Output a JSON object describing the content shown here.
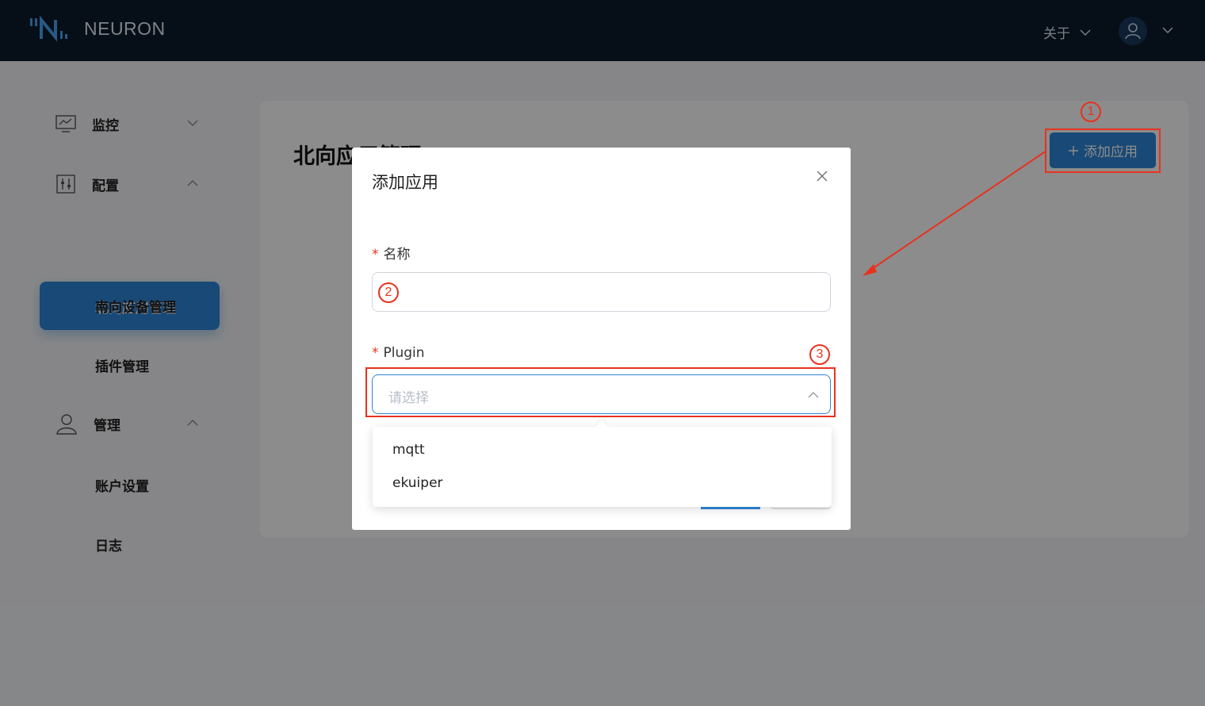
{
  "header": {
    "brand": "NEURON",
    "about_label": "关于"
  },
  "sidebar": {
    "groups": [
      {
        "label": "监控",
        "icon": "monitor-chart-icon"
      },
      {
        "label": "配置",
        "icon": "sliders-icon"
      },
      {
        "label": "管理",
        "icon": "user-icon"
      }
    ],
    "items": {
      "north_app": "北向应用管理",
      "south_device": "南向设备管理",
      "plugin": "插件管理",
      "account": "账户设置",
      "log": "日志"
    }
  },
  "main": {
    "title": "北向应用管理",
    "add_button": "添加应用"
  },
  "modal": {
    "title": "添加应用",
    "name_label": "名称",
    "plugin_label": "Plugin",
    "plugin_placeholder": "请选择",
    "required_mark": "*"
  },
  "dropdown": {
    "options": [
      "mqtt",
      "ekuiper"
    ]
  },
  "annotations": {
    "step1": "1",
    "step2": "2",
    "step3": "3"
  },
  "colors": {
    "header_bg": "#0c1a2a",
    "primary": "#2f86d8",
    "annotation": "#e8321f"
  }
}
